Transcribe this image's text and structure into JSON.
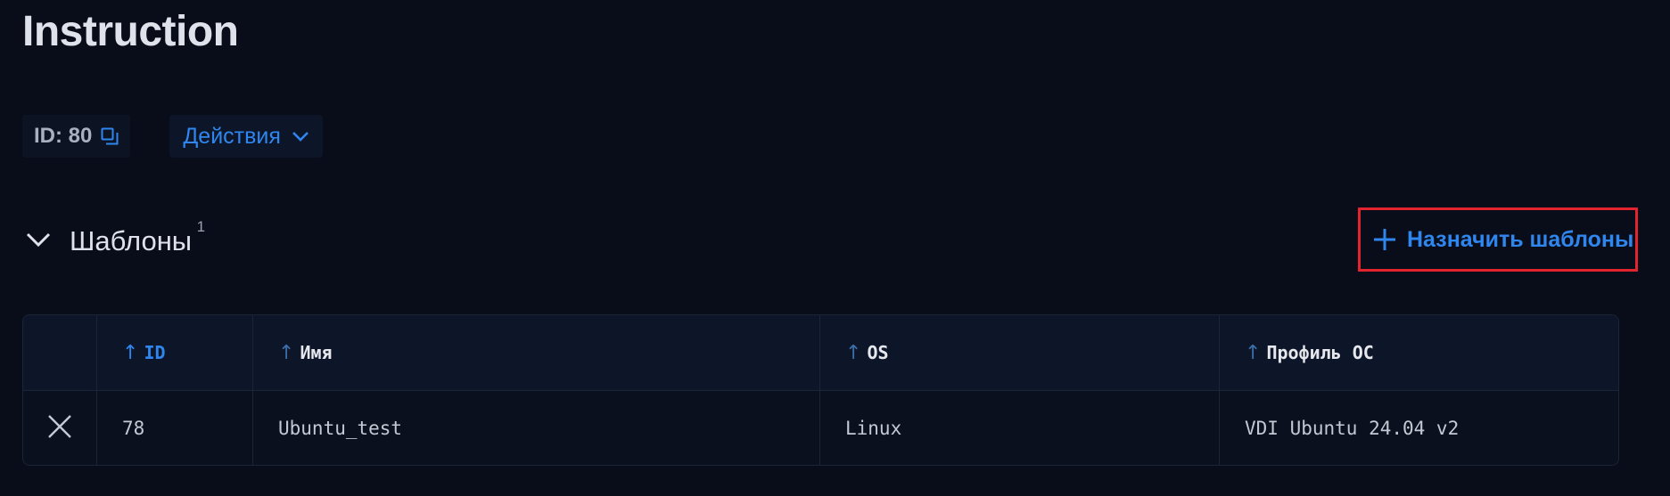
{
  "page": {
    "title": "Instruction"
  },
  "meta": {
    "id_label": "ID: 80",
    "copy_icon": "copy-icon",
    "actions_label": "Действия",
    "actions_icon": "chevron-down-icon"
  },
  "section": {
    "title": "Шаблоны",
    "count": "1",
    "toggle_icon": "chevron-down-icon",
    "assign_label": "Назначить шаблоны",
    "assign_icon": "plus-icon"
  },
  "table": {
    "columns": [
      {
        "label": "ID",
        "sort": "asc",
        "active": true
      },
      {
        "label": "Имя",
        "sort": "asc",
        "active": false
      },
      {
        "label": "OS",
        "sort": "asc",
        "active": false
      },
      {
        "label": "Профиль ОС",
        "sort": "asc",
        "active": false
      }
    ],
    "rows": [
      {
        "id": "78",
        "name": "Ubuntu_test",
        "os": "Linux",
        "profile": "VDI Ubuntu 24.04 v2"
      }
    ],
    "sort_arrow": "↑",
    "remove_icon": "close-icon"
  },
  "colors": {
    "background": "#080d19",
    "accent": "#2f86ee",
    "highlight_border": "#e3232d"
  }
}
